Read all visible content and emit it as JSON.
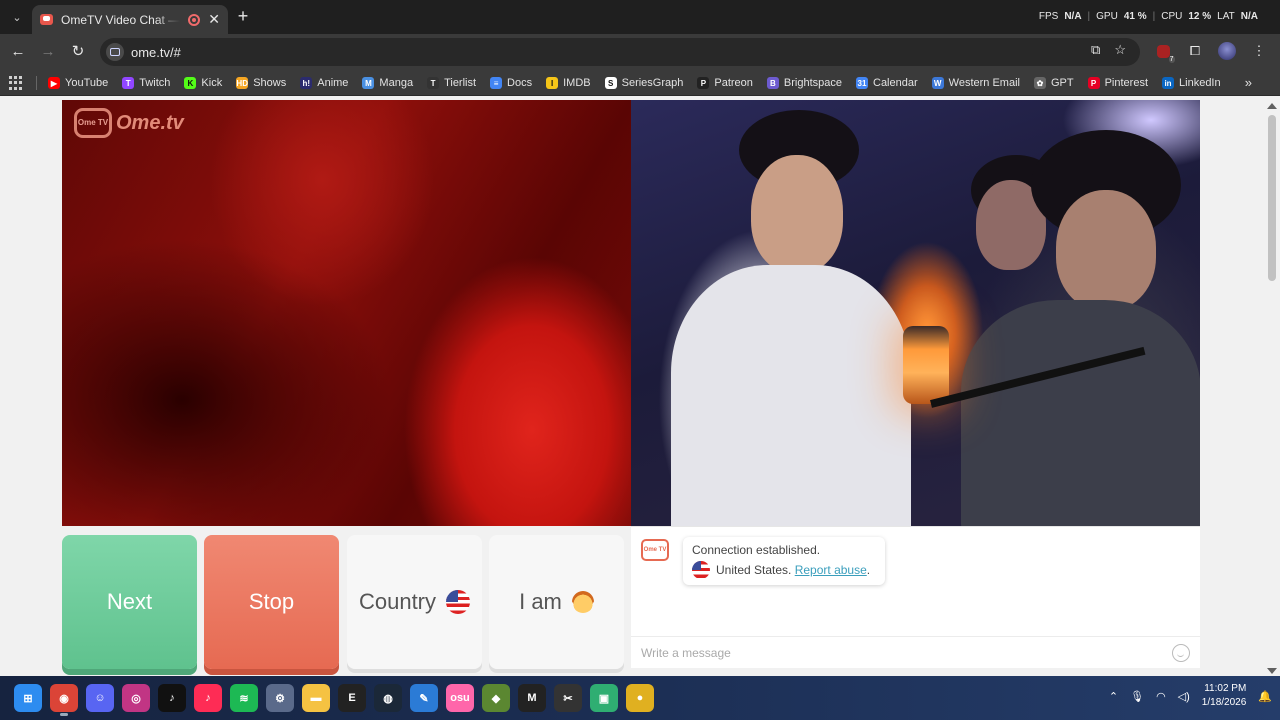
{
  "browser": {
    "tab_title": "OmeTV Video Chat — OmeTV",
    "new_tab": "+",
    "url": "ome.tv/#",
    "perf": {
      "fps_label": "FPS",
      "fps_value": "N/A",
      "gpu_label": "GPU",
      "gpu_value": "41 %",
      "cpu_label": "CPU",
      "cpu_value": "12 %",
      "lat_label": "LAT",
      "lat_value": "N/A"
    },
    "bookmarks": [
      {
        "label": "YouTube",
        "icon": "youtube-icon",
        "color": "#ff0000",
        "glyph": "▶"
      },
      {
        "label": "Twitch",
        "icon": "twitch-icon",
        "color": "#9146ff",
        "glyph": "T"
      },
      {
        "label": "Kick",
        "icon": "kick-icon",
        "color": "#53fc18",
        "glyph": "K"
      },
      {
        "label": "Shows",
        "icon": "shows-icon",
        "color": "#f5a623",
        "glyph": "HD"
      },
      {
        "label": "Anime",
        "icon": "anime-icon",
        "color": "#2b2b6e",
        "glyph": "h!"
      },
      {
        "label": "Manga",
        "icon": "manga-icon",
        "color": "#4a90e2",
        "glyph": "M"
      },
      {
        "label": "Tierlist",
        "icon": "tierlist-icon",
        "color": "#333333",
        "glyph": "T"
      },
      {
        "label": "Docs",
        "icon": "docs-icon",
        "color": "#4285f4",
        "glyph": "≡"
      },
      {
        "label": "IMDB",
        "icon": "imdb-icon",
        "color": "#f5c518",
        "glyph": "I"
      },
      {
        "label": "SeriesGraph",
        "icon": "seriesgraph-icon",
        "color": "#ffffff",
        "glyph": "S"
      },
      {
        "label": "Patreon",
        "icon": "patreon-icon",
        "color": "#222222",
        "glyph": "P"
      },
      {
        "label": "Brightspace",
        "icon": "brightspace-icon",
        "color": "#6d5bd0",
        "glyph": "B"
      },
      {
        "label": "Calendar",
        "icon": "calendar-icon",
        "color": "#4285f4",
        "glyph": "31"
      },
      {
        "label": "Western Email",
        "icon": "email-icon",
        "color": "#3c78d8",
        "glyph": "W"
      },
      {
        "label": "GPT",
        "icon": "gpt-icon",
        "color": "#666666",
        "glyph": "✿"
      },
      {
        "label": "Pinterest",
        "icon": "pinterest-icon",
        "color": "#e60023",
        "glyph": "P"
      },
      {
        "label": "LinkedIn",
        "icon": "linkedin-icon",
        "color": "#0a66c2",
        "glyph": "in"
      }
    ],
    "more_bookmarks": "»"
  },
  "page": {
    "logo_badge": "Ome TV",
    "logo_text": "Ome.tv",
    "buttons": {
      "next": "Next",
      "stop": "Stop",
      "country": "Country",
      "iam": "I am"
    },
    "chat": {
      "logo": "Ome TV",
      "status": "Connection established.",
      "country": "United States.",
      "report": "Report abuse",
      "report_suffix": ".",
      "input_placeholder": "Write a message"
    }
  },
  "taskbar": {
    "apps": [
      {
        "name": "windows-start-icon",
        "color": "#2d8cf0",
        "glyph": "⊞"
      },
      {
        "name": "chrome-icon",
        "color": "#db4437",
        "glyph": "◉",
        "active": true
      },
      {
        "name": "discord-icon",
        "color": "#5865f2",
        "glyph": "☺"
      },
      {
        "name": "instagram-icon",
        "color": "#c13584",
        "glyph": "◎"
      },
      {
        "name": "tiktok-icon",
        "color": "#111111",
        "glyph": "♪"
      },
      {
        "name": "tiktok-live-icon",
        "color": "#fe2c55",
        "glyph": "♪"
      },
      {
        "name": "spotify-icon",
        "color": "#1db954",
        "glyph": "≋"
      },
      {
        "name": "settings-icon",
        "color": "#5a6a8a",
        "glyph": "⚙"
      },
      {
        "name": "file-explorer-icon",
        "color": "#f5c242",
        "glyph": "▬"
      },
      {
        "name": "epic-games-icon",
        "color": "#222222",
        "glyph": "E"
      },
      {
        "name": "steam-icon",
        "color": "#1b2838",
        "glyph": "◍"
      },
      {
        "name": "vscode-icon",
        "color": "#2b7bd6",
        "glyph": "✎"
      },
      {
        "name": "osu-icon",
        "color": "#ff66aa",
        "glyph": "osu"
      },
      {
        "name": "minecraft-icon",
        "color": "#5b8731",
        "glyph": "◆"
      },
      {
        "name": "capcut-icon",
        "color": "#222222",
        "glyph": "M"
      },
      {
        "name": "capcut-desktop-icon",
        "color": "#333333",
        "glyph": "✂"
      },
      {
        "name": "twitch-studio-icon",
        "color": "#2fae72",
        "glyph": "▣"
      },
      {
        "name": "circle-app-icon",
        "color": "#e0b020",
        "glyph": "●"
      }
    ],
    "time": "11:02 PM",
    "date": "1/18/2026"
  }
}
